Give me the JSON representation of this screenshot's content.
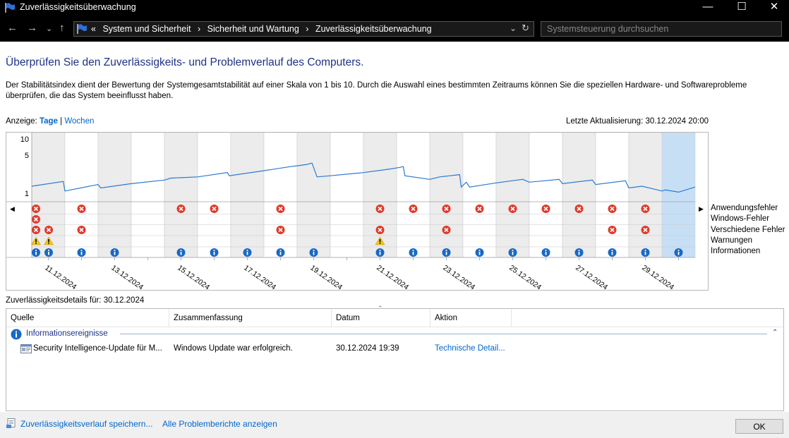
{
  "window": {
    "title": "Zuverlässigkeitsüberwachung",
    "minimize": "—",
    "maximize": "☐",
    "close": "✕"
  },
  "nav": {
    "back": "←",
    "forward": "→",
    "recent": "⌄",
    "up": "↑",
    "breadcrumb_prefix": "«",
    "breadcrumbs": [
      "System und Sicherheit",
      "Sicherheit und Wartung",
      "Zuverlässigkeitsüberwachung"
    ],
    "separator": "›",
    "search_placeholder": "Systemsteuerung durchsuchen"
  },
  "main": {
    "heading": "Überprüfen Sie den Zuverlässigkeits- und Problemverlauf des Computers.",
    "description": "Der Stabilitätsindex dient der Bewertung der Systemgesamtstabilität auf einer Skala von 1 bis 10. Durch die Auswahl eines bestimmten Zeitraums können Sie die speziellen Hardware- und Softwareprobleme überprüfen, die das System beeinflusst haben.",
    "view_label": "Anzeige:",
    "view_days": "Tage",
    "view_sep": "|",
    "view_weeks": "Wochen",
    "last_update": "Letzte Aktualisierung: 30.12.2024 20:00"
  },
  "legend": [
    "Anwendungsfehler",
    "Windows-Fehler",
    "Verschiedene Fehler",
    "Warnungen",
    "Informationen"
  ],
  "chart_data": {
    "type": "line",
    "y_ticks": [
      "10",
      "5",
      "1"
    ],
    "ylim": [
      1,
      10
    ],
    "y_scale": "log",
    "x_labels": [
      "11.12.2024",
      "13.12.2024",
      "15.12.2024",
      "17.12.2024",
      "19.12.2024",
      "21.12.2024",
      "23.12.2024",
      "25.12.2024",
      "27.12.2024",
      "29.12.2024"
    ],
    "selected_column": 20,
    "column_shading": [
      1,
      0,
      1,
      0,
      1,
      0,
      1,
      0,
      1,
      0,
      1,
      0,
      1,
      0,
      1,
      0,
      1,
      0,
      1,
      0
    ],
    "stability_line": [
      [
        0.0,
        1.35
      ],
      [
        0.95,
        1.65
      ],
      [
        1.0,
        1.1
      ],
      [
        2.0,
        1.45
      ],
      [
        2.08,
        1.25
      ],
      [
        3.0,
        1.5
      ],
      [
        4.0,
        1.75
      ],
      [
        4.2,
        1.9
      ],
      [
        5.0,
        2.0
      ],
      [
        5.9,
        2.4
      ],
      [
        5.95,
        2.1
      ],
      [
        7.0,
        2.6
      ],
      [
        7.8,
        3.1
      ],
      [
        8.0,
        3.2
      ],
      [
        8.3,
        3.4
      ],
      [
        8.45,
        3.6
      ],
      [
        8.6,
        2.0
      ],
      [
        9.0,
        2.1
      ],
      [
        10.0,
        2.4
      ],
      [
        10.8,
        2.8
      ],
      [
        11.1,
        3.0
      ],
      [
        11.2,
        3.1
      ],
      [
        11.25,
        2.1
      ],
      [
        12.0,
        1.8
      ],
      [
        12.3,
        2.0
      ],
      [
        12.9,
        2.2
      ],
      [
        12.95,
        1.3
      ],
      [
        13.1,
        1.6
      ],
      [
        13.2,
        1.3
      ],
      [
        14.0,
        1.55
      ],
      [
        14.8,
        1.8
      ],
      [
        15.0,
        1.6
      ],
      [
        15.9,
        1.8
      ],
      [
        16.0,
        1.5
      ],
      [
        16.9,
        1.75
      ],
      [
        17.0,
        1.45
      ],
      [
        17.9,
        1.7
      ],
      [
        18.0,
        1.25
      ],
      [
        18.4,
        1.35
      ],
      [
        19.0,
        1.1
      ],
      [
        19.1,
        1.15
      ],
      [
        19.5,
        1.05
      ],
      [
        20.0,
        1.3
      ]
    ],
    "events": {
      "app_errors": [
        0,
        1,
        4,
        5,
        7,
        10,
        11,
        12,
        13,
        14,
        15,
        16,
        17,
        18
      ],
      "windows_errors": [
        0
      ],
      "misc_errors": [
        0,
        0.5,
        1,
        7,
        10,
        12,
        17,
        18
      ],
      "warnings": [
        0,
        0.5,
        10
      ],
      "info": [
        0,
        0.5,
        1,
        2,
        4,
        5,
        6,
        7,
        8,
        10,
        11,
        12,
        13,
        14,
        15,
        16,
        17,
        18,
        19
      ]
    }
  },
  "details": {
    "title": "Zuverlässigkeitsdetails für: 30.12.2024",
    "columns": [
      "Quelle",
      "Zusammenfassung",
      "Datum",
      "Aktion"
    ],
    "group": "Informationsereignisse",
    "group_toggle": "⌃",
    "sort_indicator": "⌃",
    "row": {
      "source": "Security Intelligence-Update für M...",
      "summary": "Windows Update war erfolgreich.",
      "date": "30.12.2024 19:39",
      "action": "Technische Detail..."
    }
  },
  "footer": {
    "save_link": "Zuverlässigkeitsverlauf speichern...",
    "reports_link": "Alle Problemberichte anzeigen",
    "ok": "OK"
  },
  "colors": {
    "accent_blue": "#1e3287",
    "link_blue": "#0066cc",
    "line_blue": "#2a7bd0",
    "selected_column": "#c7dff5",
    "shaded_column": "#ececec",
    "error_red": "#e03a2a",
    "warning_yellow": "#f6c51b",
    "info_blue": "#1769c6"
  }
}
